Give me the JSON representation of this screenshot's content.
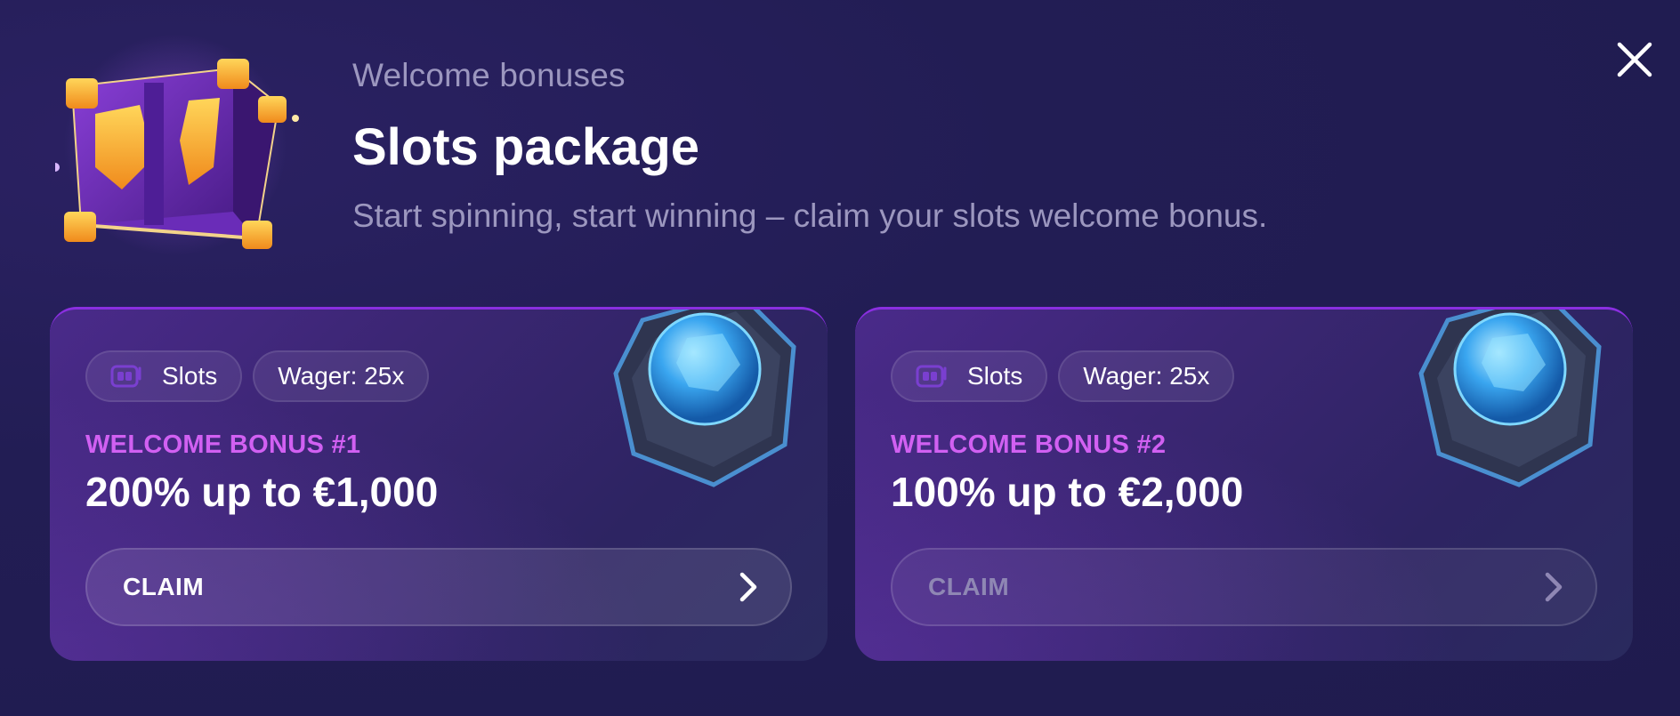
{
  "header": {
    "eyebrow": "Welcome bonuses",
    "title": "Slots package",
    "subtitle": "Start spinning, start winning – claim your slots welcome bonus."
  },
  "close": {
    "icon": "close-icon"
  },
  "cards": [
    {
      "tags": [
        {
          "icon": "slot-machine-icon",
          "label": "Slots"
        },
        {
          "label": "Wager: 25x"
        }
      ],
      "kicker": "WELCOME BONUS #1",
      "amount": "200% up to €1,000",
      "claim_label": "CLAIM",
      "claim_enabled": true
    },
    {
      "tags": [
        {
          "icon": "slot-machine-icon",
          "label": "Slots"
        },
        {
          "label": "Wager: 25x"
        }
      ],
      "kicker": "WELCOME BONUS #2",
      "amount": "100% up to €2,000",
      "claim_label": "CLAIM",
      "claim_enabled": false
    }
  ],
  "colors": {
    "background": "#211c52",
    "accent_pink": "#d160f2",
    "card_border": "#8a2fe0",
    "muted_text": "#9c97bf"
  }
}
